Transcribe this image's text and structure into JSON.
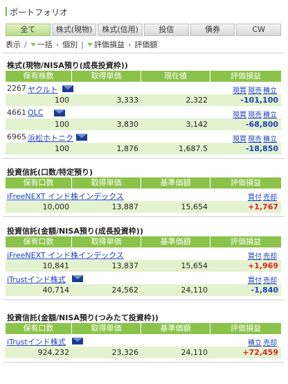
{
  "header": {
    "title": "ポートフォリオ"
  },
  "tabs": [
    "全て",
    "株式(現物)",
    "株式(信用)",
    "投信",
    "債券",
    "CW"
  ],
  "controls": {
    "display": "表示",
    "bulk": "一括",
    "individual": "個別",
    "pl": "評価損益",
    "amount": "評価額"
  },
  "sections": {
    "stocks": {
      "title": "株式(現物/NISA預り(成長投資枠))",
      "headers": [
        "保有株数",
        "取得単価",
        "現在値",
        "評価損益"
      ],
      "rows": [
        {
          "code": "2267",
          "name": "ヤクルト",
          "acts": [
            "現買",
            "現売",
            "積立"
          ],
          "qty": "100",
          "cost": "3,333",
          "price": "2,322",
          "pl": "-101,100"
        },
        {
          "code": "4661",
          "name": "OLC",
          "acts": [
            "現買",
            "現売",
            "積立"
          ],
          "qty": "100",
          "cost": "3,830",
          "price": "3,142",
          "pl": "-68,800"
        },
        {
          "code": "6965",
          "name": "浜松ホトニク",
          "acts": [
            "現買",
            "現売",
            "積立"
          ],
          "qty": "100",
          "cost": "1,876",
          "price": "1,687.5",
          "pl": "-18,850"
        }
      ]
    },
    "funds_specific": {
      "title": "投資信託(口数/特定預り)",
      "headers": [
        "保有口数",
        "取得単価",
        "基準価額",
        "評価損益"
      ],
      "rows": [
        {
          "name": "iFreeNEXT インド株インデックス",
          "acts": [
            "買付",
            "売却"
          ],
          "qty": "10,000",
          "cost": "13,887",
          "price": "15,654",
          "pl": "+1,767"
        }
      ]
    },
    "funds_growth": {
      "title": "投資信託(金額/NISA預り(成長投資枠))",
      "headers": [
        "保有口数",
        "取得単価",
        "基準価額",
        "評価損益"
      ],
      "rows": [
        {
          "name": "iFreeNEXT インド株インデックス",
          "acts": [
            "買付",
            "売却"
          ],
          "qty": "10,841",
          "cost": "13,837",
          "price": "15,654",
          "pl": "+1,969"
        },
        {
          "name": "iTrustインド株式",
          "acts": [
            "買付",
            "売却"
          ],
          "qty": "40,714",
          "cost": "24,562",
          "price": "24,110",
          "pl": "-1,840"
        }
      ]
    },
    "funds_tsumitate": {
      "title": "投資信託(金額/NISA預り(つみたて投資枠))",
      "headers": [
        "保有口数",
        "取得単価",
        "基準価額",
        "評価損益"
      ],
      "rows": [
        {
          "name": "iTrustインド株式",
          "acts": [
            "積立",
            "売却"
          ],
          "qty": "924,232",
          "cost": "23,326",
          "price": "24,110",
          "pl": "+72,459"
        }
      ]
    }
  },
  "colors": {
    "accent": "#8bc34a",
    "value_row": "#e3f2cf",
    "negative": "#1a3fb8",
    "positive": "#e02020"
  }
}
